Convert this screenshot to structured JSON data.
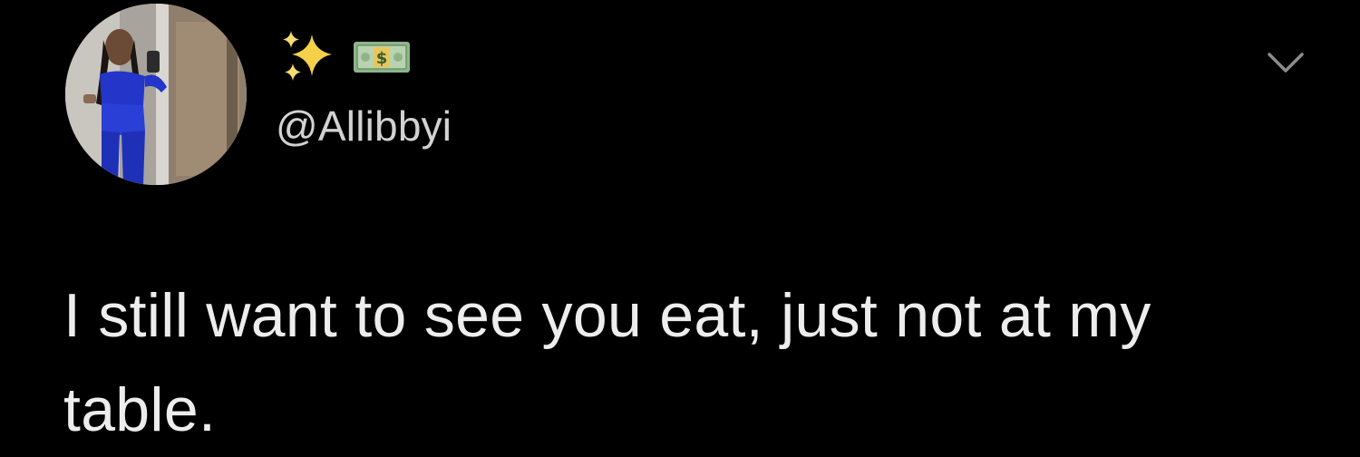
{
  "tweet": {
    "display_name_emojis": [
      "sparkles-icon",
      "dollar-banknote-icon"
    ],
    "handle": "@Allibbyi",
    "text": "I still want to see you eat, just not at my table.",
    "more_icon": "chevron-down-icon"
  },
  "colors": {
    "background": "#000000",
    "text": "#ededed",
    "handle": "#d2d2d2",
    "sparkle": "#f5d04b",
    "banknote": "#8fb48a",
    "chevron": "#8c8c8c"
  }
}
